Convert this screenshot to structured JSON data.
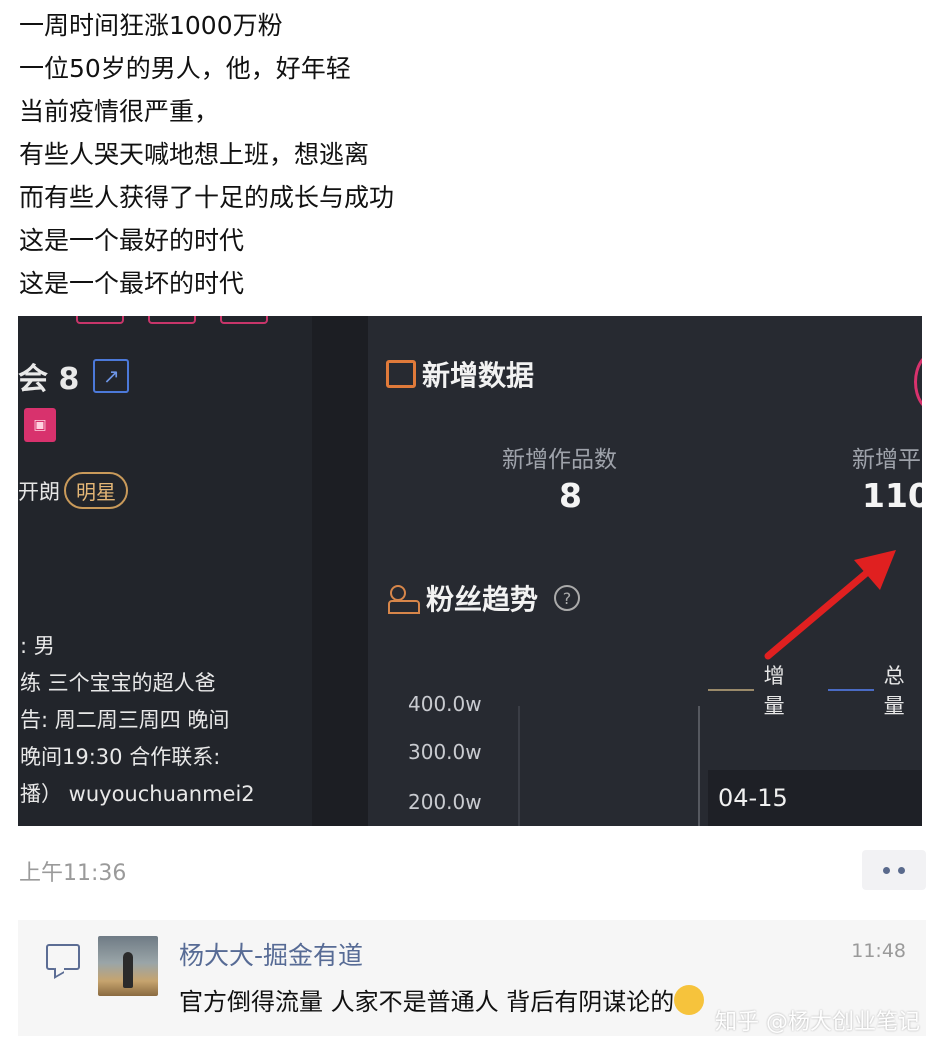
{
  "post": {
    "lines": [
      "一周时间狂涨1000万粉",
      "一位50岁的男人，他，好年轻",
      "当前疫情很严重，",
      "有些人哭天喊地想上班，想逃离",
      "而有些人获得了十足的成长与成功",
      "这是一个最好的时代",
      "这是一个最坏的时代"
    ]
  },
  "screenshot": {
    "left_panel": {
      "icon_glyphs": "会 8",
      "name_text": "开朗",
      "badge": "明星",
      "profile_lines": [
        ": 男",
        "练 三个宝宝的超人爸",
        "告: 周二周三周四 晚间",
        "晚间19:30 合作联系:",
        "播） wuyouchuanmei2"
      ]
    },
    "right_panel": {
      "new_data_title": "新增数据",
      "stat1_label": "新增作品数",
      "stat1_value": "8",
      "stat2_label": "新增平",
      "stat2_value": "110",
      "fans_title": "粉丝趋势",
      "help_icon": "?",
      "legend_increase": "增量",
      "legend_total": "总量",
      "date_label": "04-15"
    },
    "chart_data": {
      "type": "line",
      "title": "粉丝趋势",
      "y_ticks": [
        "400.0w",
        "300.0w",
        "200.0w"
      ],
      "series": [
        {
          "name": "增量",
          "color": "#9a8a6a"
        },
        {
          "name": "总量",
          "color": "#4a6bc4"
        }
      ],
      "x": [
        "04-15"
      ]
    }
  },
  "footer": {
    "post_time": "上午11:36"
  },
  "comment": {
    "name": "杨大大-掘金有道",
    "time": "11:48",
    "text": "官方倒得流量 人家不是普通人 背后有阴谋论的",
    "emoji": "thinking-face"
  },
  "watermark": "知乎 @杨大创业笔记",
  "colors": {
    "link_blue": "#576b95",
    "dark_bg": "#22252b",
    "accent_pink": "#d8326d",
    "arrow_red": "#e02020"
  }
}
